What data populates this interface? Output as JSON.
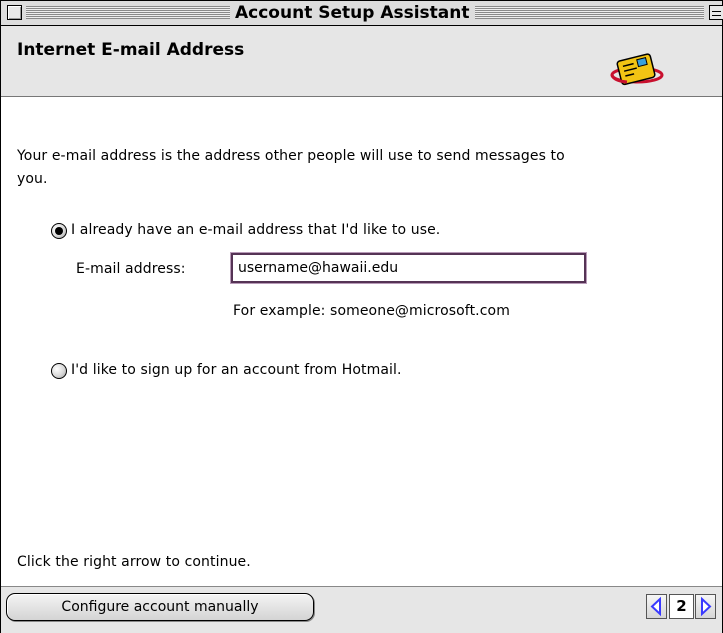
{
  "window": {
    "title": "Account Setup Assistant"
  },
  "header": {
    "title": "Internet E-mail Address",
    "icon": "mail-envelope-icon"
  },
  "main": {
    "intro_line1": "Your e-mail address is the address other people will use to send messages to",
    "intro_line2": "you.",
    "options": [
      {
        "label": "I already have an e-mail address that I'd like to use.",
        "selected": true
      },
      {
        "label": "I'd like to sign up for an account from Hotmail.",
        "selected": false
      }
    ],
    "email_field": {
      "label": "E-mail address:",
      "value": "username@hawaii.edu"
    },
    "example": "For example: someone@microsoft.com",
    "instruction": "Click the right arrow to continue."
  },
  "footer": {
    "configure_label": "Configure account manually",
    "page_number": "2"
  },
  "colors": {
    "input_border": "#553355",
    "nav_arrow": "#3a3aff",
    "icon_yellow": "#f2c414",
    "icon_red": "#c8102e"
  }
}
